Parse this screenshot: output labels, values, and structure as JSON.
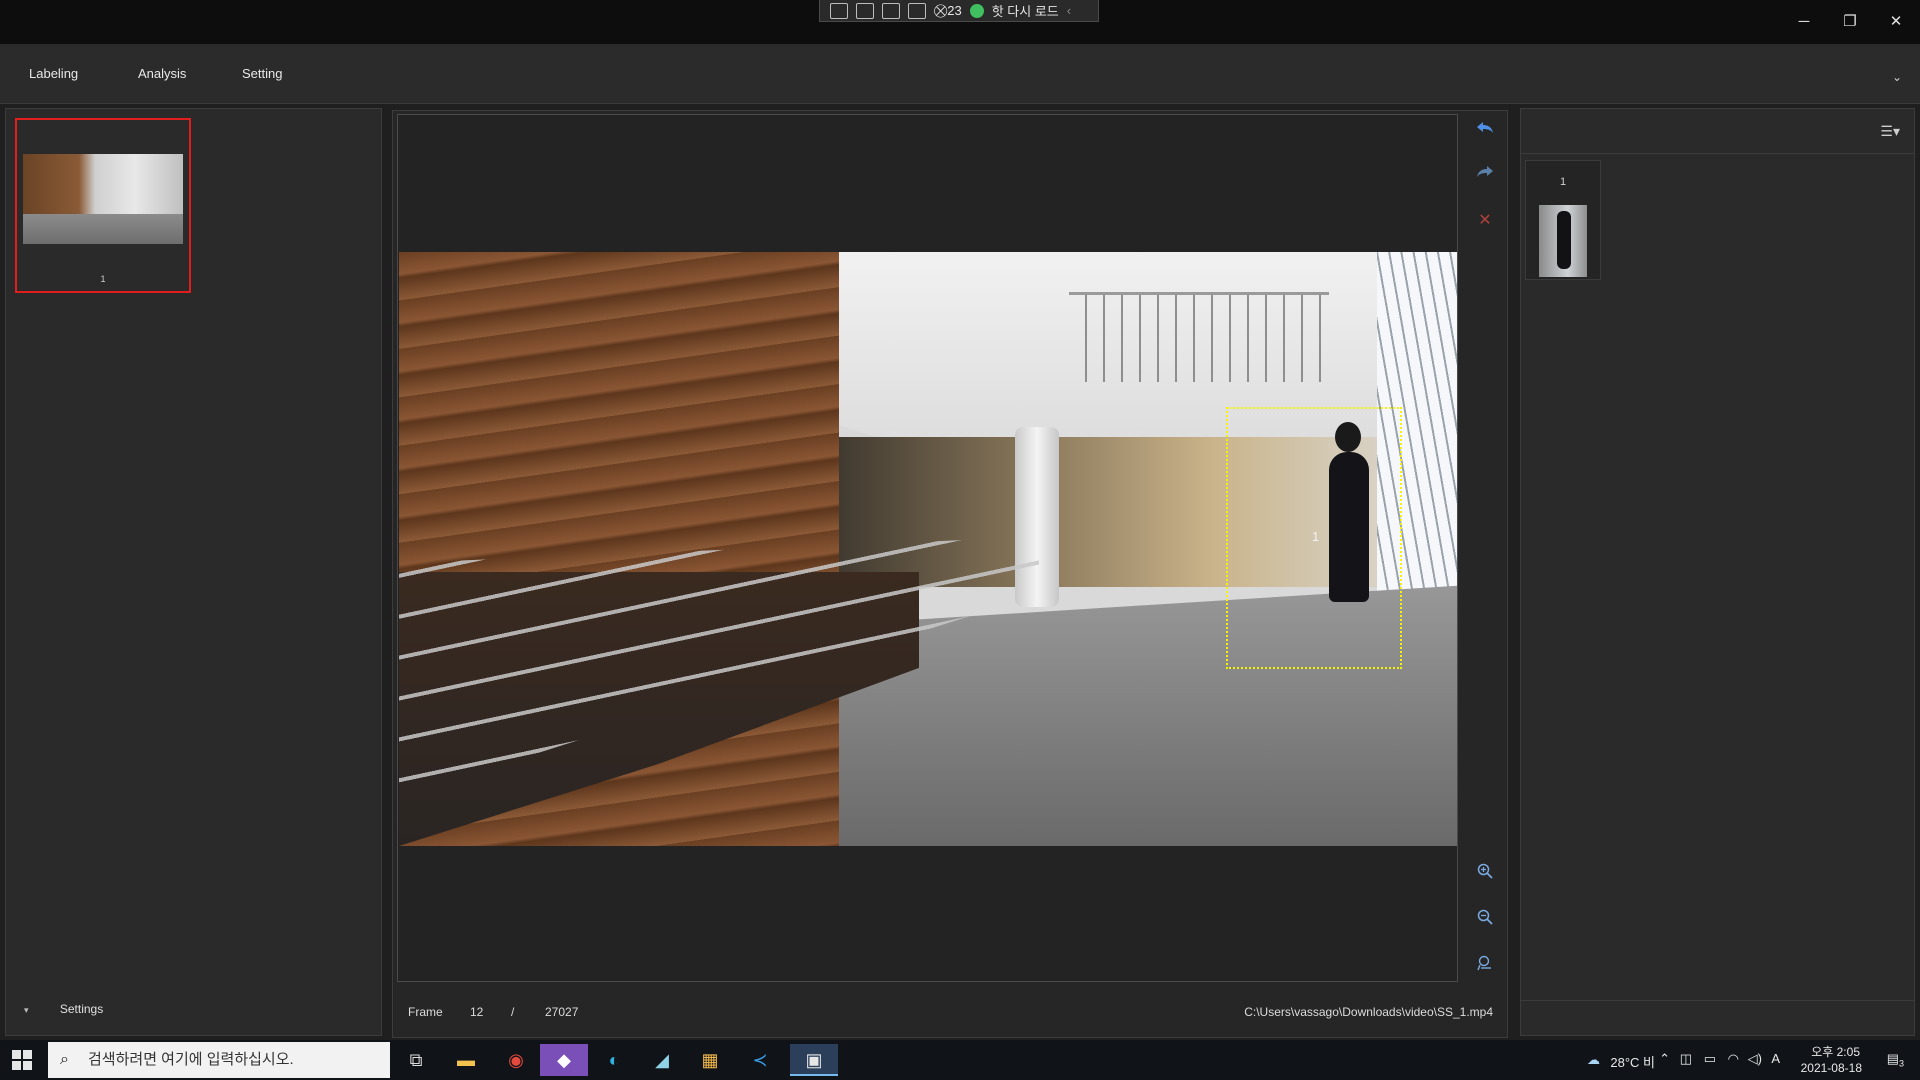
{
  "hot_toolbar": {
    "counter": "23",
    "reload_label": "핫 다시 로드",
    "chevron": "‹"
  },
  "window_controls": {
    "minimize": "─",
    "restore": "❐",
    "close": "✕"
  },
  "menu": {
    "items": [
      "Labeling",
      "Analysis",
      "Setting"
    ],
    "collapse": "⌄"
  },
  "left_panel": {
    "thumbnail_number": "1",
    "settings_chevron": "▾",
    "settings_label": "Settings"
  },
  "viewer": {
    "bbox_id": "1"
  },
  "side_tools": {
    "undo_icon": "undo-icon",
    "redo_icon": "redo-icon",
    "delete_icon": "close-icon",
    "zoom_in_icon": "zoom-in-icon",
    "zoom_out_icon": "zoom-out-icon",
    "fit_icon": "fit-icon",
    "colors": {
      "undo": "#4f8fe6",
      "redo": "#5a7fa8",
      "delete": "#b0413a",
      "zoom": "#7aa9e0"
    }
  },
  "status": {
    "frame_label": "Frame",
    "frame_current": "12",
    "separator": "/",
    "frame_total": "27027",
    "file_path": "C:\\Users\\vassago\\Downloads\\video\\SS_1.mp4"
  },
  "right_panel": {
    "crop_number": "1",
    "menu_icon": "list-menu-icon"
  },
  "taskbar": {
    "search_placeholder": "검색하려면 여기에 입력하십시오.",
    "weather": "28°C 비",
    "ime": "A",
    "time": "오후 2:05",
    "date": "2021-08-18",
    "notification_count": "3",
    "apps": [
      "task-view-icon",
      "file-explorer-icon",
      "chrome-icon",
      "visual-studio-icon",
      "edge-icon",
      "app-icon",
      "store-icon",
      "vscode-icon",
      "labeling-app-icon"
    ]
  },
  "colors": {
    "bbox": "#f2f20a",
    "selection": "#e01e1e",
    "background": "#1f1f1f"
  }
}
